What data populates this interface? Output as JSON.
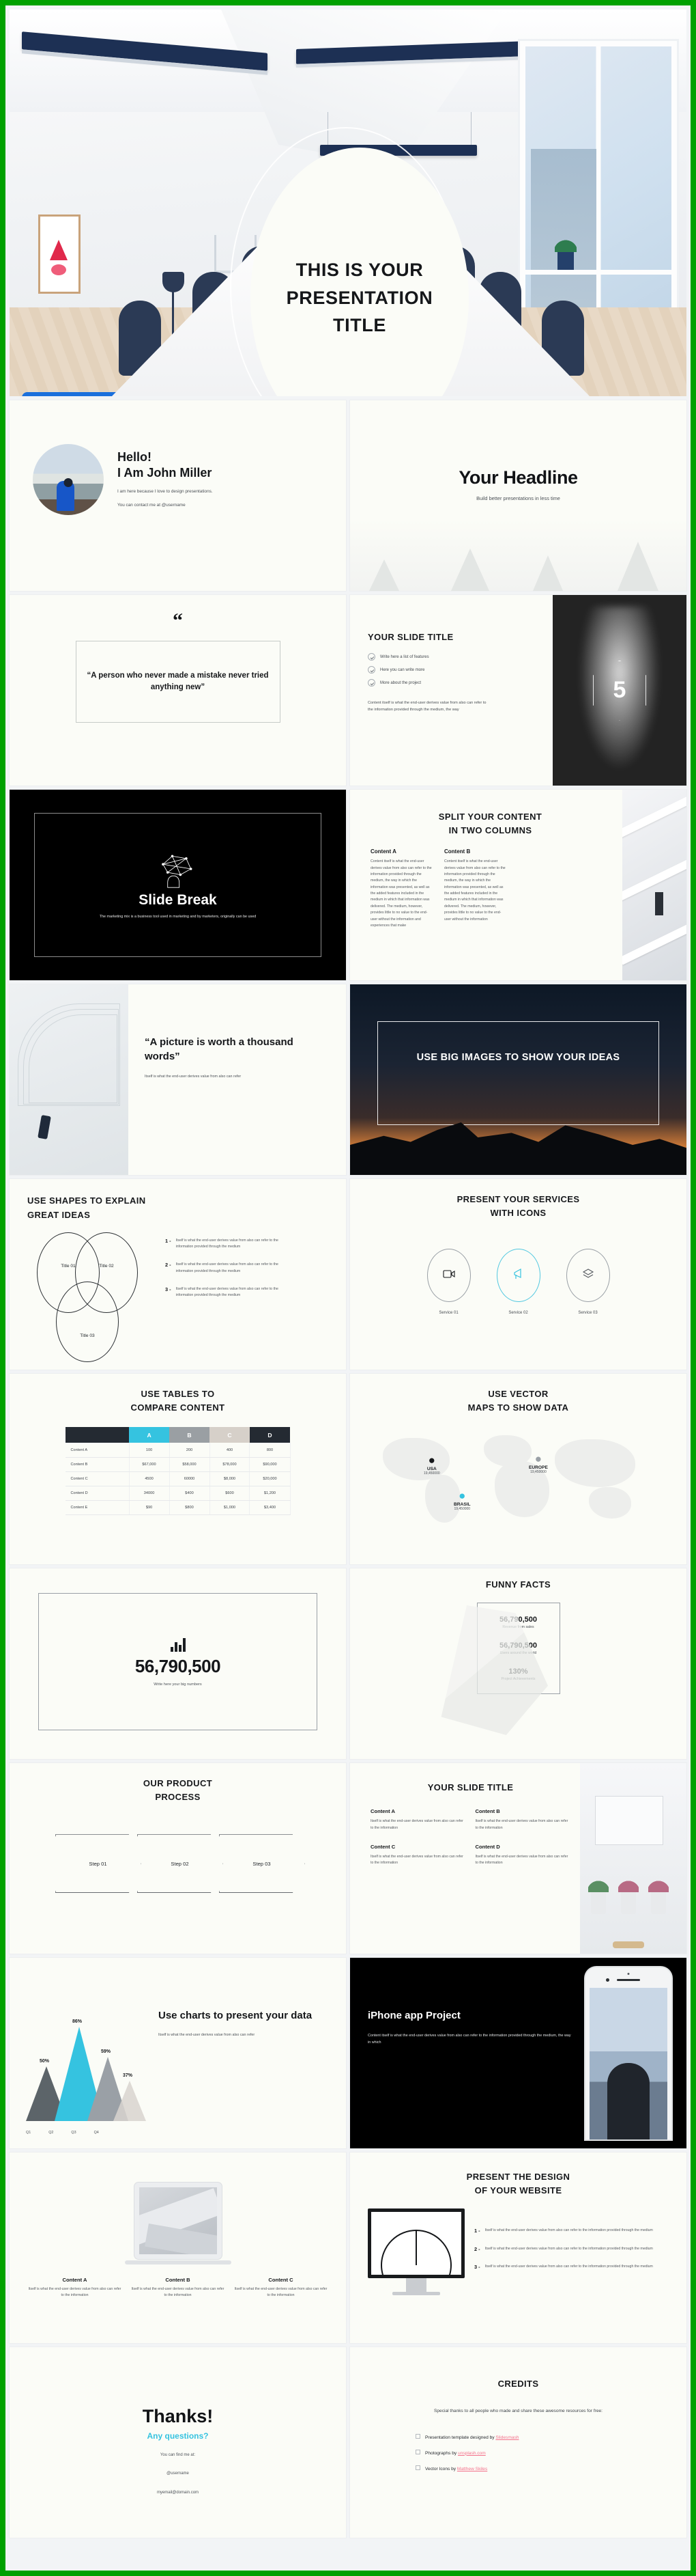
{
  "theme": {
    "accent": "#35c3e0",
    "ink": "#15171a",
    "paper": "#fbfcf7",
    "dark": "#000000",
    "border_green": "#00a000",
    "link": "#f4718b"
  },
  "hero": {
    "title": "THIS IS YOUR PRESENTATION TITLE"
  },
  "slides": {
    "hello": {
      "greeting": "Hello!",
      "name": "I Am John Miller",
      "line1": "I am here because I love to design presentations.",
      "line2": "You can contact me at @username"
    },
    "headline": {
      "title": "Your Headline",
      "subtitle": "Build better presentations in less time"
    },
    "quote": {
      "mark": "“",
      "text": "“A person who never made a mistake never tried anything new”"
    },
    "features": {
      "title": "YOUR SLIDE TITLE",
      "items": [
        "Write here a list of features",
        "Here you can write more",
        "More about the project"
      ],
      "body": "Content itself is what the end-user derives value from also can refer to the information provided through the medium, the way",
      "badge_number": "5"
    },
    "slide_break": {
      "title": "Slide Break",
      "body": "The marketing mix is a business tool used in marketing and by marketers, originally can be used"
    },
    "split_columns": {
      "title_line1": "SPLIT YOUR CONTENT",
      "title_line2": "IN TWO COLUMNS",
      "col_a_title": "Content A",
      "col_a_body": "Content itself is what the end-user derives value from also can refer to the information provided through the medium, the way in which the information was presented, as well as the added features included in the medium in which that information was delivered. The medium, however, provides little to no value to the end-user without the information and experiences that make",
      "col_b_title": "Content B",
      "col_b_body": "Content itself is what the end-user derives value from also can refer to the information provided through the medium, the way in which the information was presented, as well as the added features included in the medium in which that information was delivered. The medium, however, provides little to no value to the end-user without the information"
    },
    "picture_quote": {
      "title": "“A picture is worth a thousand words”",
      "body": "Itself is what the end-user derives value from also can refer"
    },
    "big_images": {
      "title": "USE BIG IMAGES TO SHOW YOUR IDEAS"
    },
    "shapes": {
      "title_line1": "USE SHAPES TO EXPLAIN",
      "title_line2": "GREAT IDEAS",
      "circles": [
        "Title 01",
        "Title 02",
        "Title 03"
      ],
      "points": [
        {
          "num": "1 -",
          "text": "Itself is what the end-user derives value from also can refer to the information provided through the medium"
        },
        {
          "num": "2 -",
          "text": "Itself is what the end-user derives value from also can refer to the information provided through the medium"
        },
        {
          "num": "3 -",
          "text": "Itself is what the end-user derives value from also can refer to the information provided through the medium"
        }
      ]
    },
    "services": {
      "title_line1": "PRESENT YOUR SERVICES",
      "title_line2": "WITH ICONS",
      "items": [
        {
          "label": "Service 01",
          "icon": "video-camera-icon"
        },
        {
          "label": "Service 02",
          "icon": "megaphone-icon"
        },
        {
          "label": "Service 03",
          "icon": "layers-icon"
        }
      ]
    },
    "table": {
      "title_line1": "USE TABLES TO",
      "title_line2": "COMPARE CONTENT",
      "headers": [
        "",
        "A",
        "B",
        "C",
        "D"
      ],
      "rows": [
        [
          "Content A",
          "100",
          "200",
          "400",
          "800"
        ],
        [
          "Content B",
          "$67,000",
          "$58,000",
          "$78,000",
          "$90,000"
        ],
        [
          "Content C",
          "4500",
          "60000",
          "$8,000",
          "$20,000"
        ],
        [
          "Content D",
          "34000",
          "$400",
          "$600",
          "$1,200"
        ],
        [
          "Content E",
          "$90",
          "$800",
          "$1,000",
          "$3,400"
        ]
      ]
    },
    "map": {
      "title_line1": "USE VECTOR",
      "title_line2": "MAPS TO SHOW DATA",
      "pins": [
        {
          "name": "USA",
          "value": "19,450000",
          "color": "#16181b"
        },
        {
          "name": "BRASIL",
          "value": "19,450000",
          "color": "#35c3e0"
        },
        {
          "name": "EUROPE",
          "value": "19,450000",
          "color": "#9aa0a6"
        }
      ]
    },
    "big_number": {
      "value": "56,790,500",
      "caption": "Write here your big numbers"
    },
    "funny_facts": {
      "title": "FUNNY FACTS",
      "items": [
        {
          "value": "56,790,500",
          "label": "Revenue from sales"
        },
        {
          "value": "56,790,500",
          "label": "Users around the world"
        },
        {
          "value": "130%",
          "label": "Project Achievements"
        }
      ]
    },
    "process": {
      "title_line1": "OUR PRODUCT",
      "title_line2": "PROCESS",
      "steps": [
        "Step 01",
        "Step 02",
        "Step 03"
      ]
    },
    "content_grid": {
      "title": "YOUR SLIDE TITLE",
      "items": [
        {
          "heading": "Content A",
          "body": "Itself is what the end-user derives value from also can refer to the information"
        },
        {
          "heading": "Content B",
          "body": "Itself is what the end-user derives value from also can refer to the information"
        },
        {
          "heading": "Content C",
          "body": "Itself is what the end-user derives value from also can refer to the information"
        },
        {
          "heading": "Content D",
          "body": "Itself is what the end-user derives value from also can refer to the information"
        }
      ]
    },
    "charts": {
      "title": "Use charts to present your data",
      "body": "Itself is what the end-user derives value from also can refer"
    },
    "iphone": {
      "title": "iPhone app Project",
      "body": "Content itself is what the end-user derives value from also can refer to the information provided through the medium, the way in which"
    },
    "website_three": {
      "items": [
        {
          "heading": "Content A",
          "body": "Itself is what the end-user derives value from also can refer to the information"
        },
        {
          "heading": "Content B",
          "body": "Itself is what the end-user derives value from also can refer to the information"
        },
        {
          "heading": "Content C",
          "body": "Itself is what the end-user derives value from also can refer to the information"
        }
      ]
    },
    "website_design": {
      "title_line1": "PRESENT THE DESIGN",
      "title_line2": "OF YOUR WEBSITE",
      "points": [
        {
          "num": "1 -",
          "text": "Itself is what the end-user derives value from also can refer to the information provided through the medium"
        },
        {
          "num": "2 -",
          "text": "Itself is what the end-user derives value from also can refer to the information provided through the medium"
        },
        {
          "num": "3 -",
          "text": "Itself is what the end-user derives value from also can refer to the information provided through the medium"
        }
      ]
    },
    "thanks": {
      "title": "Thanks!",
      "question": "Any questions?",
      "find": "You can find me at:",
      "username": "@username",
      "email": "myemail@domain.com"
    },
    "credits": {
      "title": "CREDITS",
      "intro": "Special thanks to all people who made and share these awesome resources for free:",
      "items": [
        {
          "prefix": "Presentation template designed by ",
          "link": "Slidesmash"
        },
        {
          "prefix": "Photographs by ",
          "link": "unsplash.com"
        },
        {
          "prefix": "Vector Icons by ",
          "link": "Matthew Skiles"
        }
      ]
    }
  },
  "chart_data": {
    "type": "bar",
    "title": "Use charts to present your data",
    "categories": [
      "Q1",
      "Q2",
      "Q3",
      "Q4"
    ],
    "values": [
      50,
      86,
      59,
      37
    ],
    "value_labels": [
      "50%",
      "86%",
      "59%",
      "37%"
    ],
    "colors": [
      "#5c6469",
      "#35c3e0",
      "#9aa0a6",
      "#d8d4cf"
    ],
    "xlabel": "",
    "ylabel": "",
    "ylim": [
      0,
      100
    ],
    "grid": false,
    "legend": "none",
    "note": "triangle-shaped mountain bars"
  }
}
